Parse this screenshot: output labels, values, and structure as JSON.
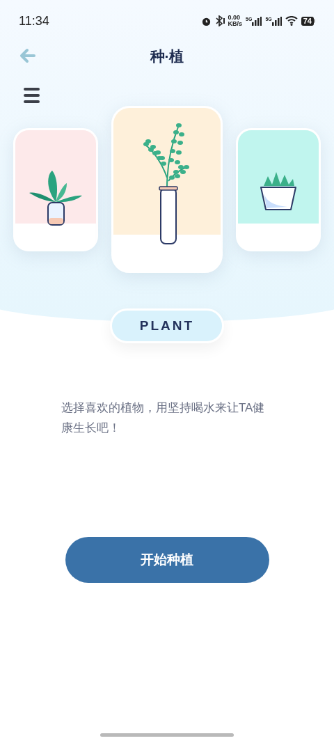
{
  "status_bar": {
    "time": "11:34",
    "speed_value": "0.00",
    "speed_unit": "KB/s",
    "network_1": "5G",
    "network_2": "5G",
    "battery": "74"
  },
  "header": {
    "title": "种·植"
  },
  "plants": [
    {
      "kind": "leafy",
      "color": "#fde9ea",
      "selected": false
    },
    {
      "kind": "sprig",
      "color": "#fef0da",
      "selected": true
    },
    {
      "kind": "succulent",
      "color": "#c0f5ee",
      "selected": false
    }
  ],
  "label": "PLANT",
  "description": "选择喜欢的植物，用坚持喝水来让TA健康生长吧！",
  "start_button": "开始种植"
}
